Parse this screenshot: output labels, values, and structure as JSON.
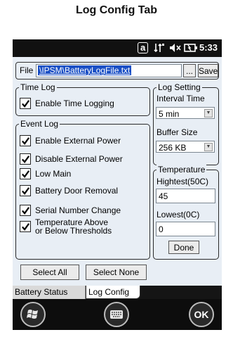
{
  "caption": "Log Config Tab",
  "status": {
    "notification": "a",
    "time": "5:33"
  },
  "file": {
    "label": "File",
    "path": "\\IPSM\\BatteryLogFile.txt",
    "browse_label": "...",
    "save_label": "Save"
  },
  "time_log": {
    "title": "Time Log",
    "enable_label": "Enable Time Logging",
    "enabled": true
  },
  "log_setting": {
    "title": "Log Setting",
    "interval_label": "Interval Time",
    "interval_value": "5 min",
    "buffer_label": "Buffer Size",
    "buffer_value": "256 KB"
  },
  "event_log": {
    "title": "Event Log",
    "items": [
      {
        "label": "Enable External Power",
        "checked": true
      },
      {
        "label": "Disable External Power",
        "checked": true
      },
      {
        "label": "Low Main",
        "checked": true
      },
      {
        "label": "Battery Door Removal",
        "checked": true
      },
      {
        "label": "Serial Number Change",
        "checked": true
      },
      {
        "label": "Temperature Above",
        "label2": "or Below Thresholds",
        "checked": true
      }
    ]
  },
  "temperature": {
    "title": "Temperature",
    "highest_label": "Hightest(50C)",
    "highest_value": "45",
    "lowest_label": "Lowest(0C)",
    "lowest_value": "0",
    "done_label": "Done"
  },
  "buttons": {
    "select_all": "Select All",
    "select_none": "Select None"
  },
  "tabs": [
    {
      "label": "Battery Status",
      "active": false
    },
    {
      "label": "Log Config",
      "active": true
    }
  ],
  "softkeys": {
    "ok": "OK"
  }
}
